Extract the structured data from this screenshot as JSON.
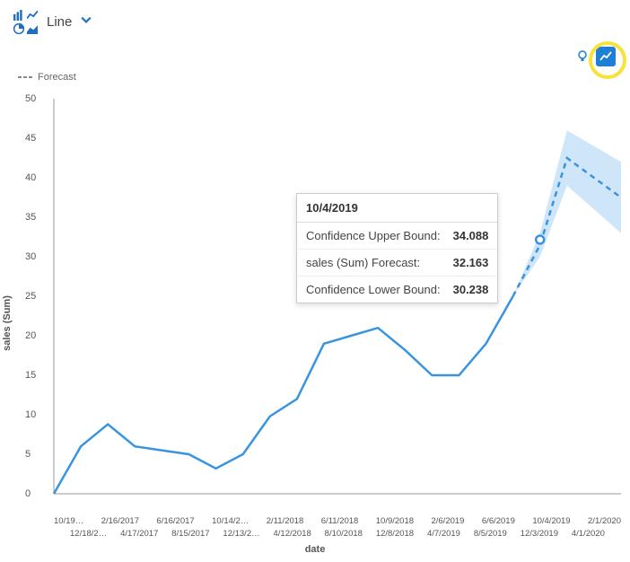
{
  "chart_type_selector": {
    "label": "Line",
    "chevron_icon": "chevron-down"
  },
  "toolbar": {
    "insight_icon": "lightbulb",
    "forecast_icon": "trend-line"
  },
  "legend": {
    "forecast_label": "Forecast"
  },
  "axes": {
    "y_title": "sales (Sum)",
    "x_title": "date",
    "y_ticks": [
      "0",
      "5",
      "10",
      "15",
      "20",
      "25",
      "30",
      "35",
      "40",
      "45",
      "50"
    ],
    "x_ticks_top": [
      "10/19…",
      "2/16/2017",
      "6/16/2017",
      "10/14/2…",
      "2/11/2018",
      "6/11/2018",
      "10/9/2018",
      "2/6/2019",
      "6/6/2019",
      "10/4/2019",
      "2/1/2020"
    ],
    "x_ticks_bottom": [
      "12/18/2…",
      "4/17/2017",
      "8/15/2017",
      "12/13/2…",
      "4/12/2018",
      "8/10/2018",
      "12/8/2018",
      "4/7/2019",
      "8/5/2019",
      "12/3/2019",
      "4/1/2020"
    ]
  },
  "tooltip": {
    "title": "10/4/2019",
    "rows": [
      {
        "k": "Confidence Upper Bound:",
        "v": "34.088"
      },
      {
        "k": "sales (Sum) Forecast:",
        "v": "32.163"
      },
      {
        "k": "Confidence Lower Bound:",
        "v": "30.238"
      }
    ]
  },
  "colors": {
    "line": "#3994e0",
    "forecast": "#3994e0",
    "band": "#9dcdf0",
    "axis": "#999"
  },
  "chart_data": {
    "type": "line",
    "xlabel": "date",
    "ylabel": "sales (Sum)",
    "ylim": [
      0,
      50
    ],
    "x": [
      "10/19/2016",
      "12/18/2016",
      "2/16/2017",
      "4/17/2017",
      "6/16/2017",
      "8/15/2017",
      "10/14/2017",
      "12/13/2017",
      "2/11/2018",
      "4/12/2018",
      "6/11/2018",
      "8/10/2018",
      "10/9/2018",
      "12/8/2018",
      "2/6/2019",
      "4/7/2019",
      "6/6/2019",
      "8/5/2019",
      "10/4/2019",
      "12/3/2019",
      "2/1/2020",
      "4/1/2020"
    ],
    "series": [
      {
        "name": "sales (Sum)",
        "style": "solid",
        "values": [
          0,
          6,
          8.8,
          6,
          5.5,
          5,
          3.2,
          5,
          9.8,
          12,
          19,
          20,
          21,
          18.2,
          15,
          15,
          19,
          25,
          null,
          null,
          null,
          null
        ]
      },
      {
        "name": "Forecast",
        "style": "dashed",
        "values": [
          null,
          null,
          null,
          null,
          null,
          null,
          null,
          null,
          null,
          null,
          null,
          null,
          null,
          null,
          null,
          null,
          null,
          25,
          31.5,
          42.5,
          40,
          37.5
        ]
      },
      {
        "name": "Confidence Upper Bound",
        "style": "band-upper",
        "values": [
          null,
          null,
          null,
          null,
          null,
          null,
          null,
          null,
          null,
          null,
          null,
          null,
          null,
          null,
          null,
          null,
          null,
          25,
          33,
          46,
          44,
          42
        ]
      },
      {
        "name": "Confidence Lower Bound",
        "style": "band-lower",
        "values": [
          null,
          null,
          null,
          null,
          null,
          null,
          null,
          null,
          null,
          null,
          null,
          null,
          null,
          null,
          null,
          null,
          null,
          25,
          30,
          39,
          36,
          33
        ]
      }
    ],
    "highlight_point": {
      "x": "10/4/2019",
      "upper": 34.088,
      "forecast": 32.163,
      "lower": 30.238
    }
  }
}
